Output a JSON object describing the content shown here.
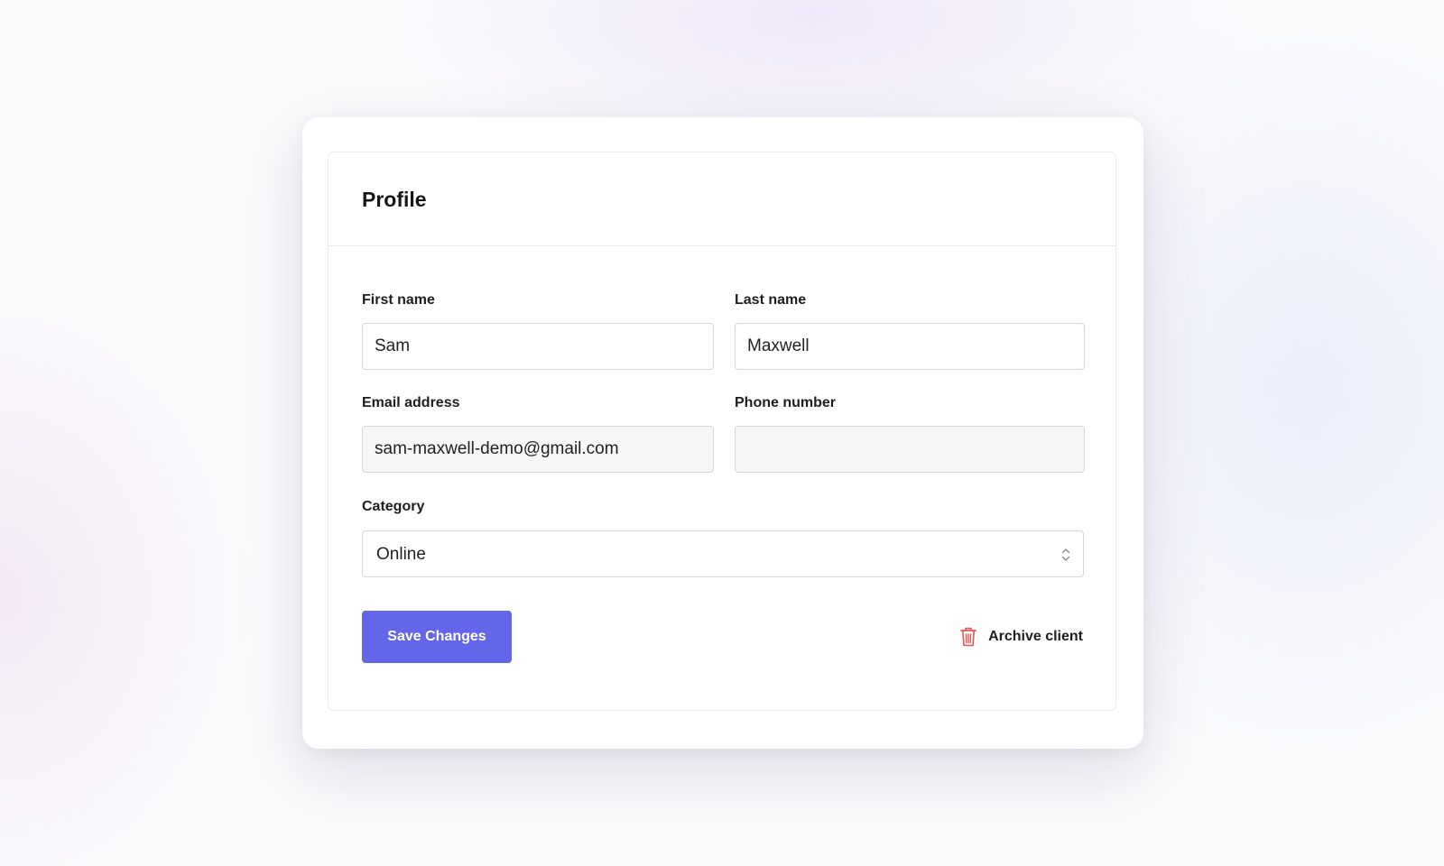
{
  "profile": {
    "title": "Profile",
    "first_name": {
      "label": "First name",
      "value": "Sam"
    },
    "last_name": {
      "label": "Last name",
      "value": "Maxwell"
    },
    "email": {
      "label": "Email address",
      "value": "sam-maxwell-demo@gmail.com"
    },
    "phone": {
      "label": "Phone number",
      "value": ""
    },
    "category": {
      "label": "Category",
      "selected": "Online"
    },
    "save_label": "Save Changes",
    "archive_label": "Archive client"
  },
  "colors": {
    "primary": "#6366e8",
    "danger": "#e05656",
    "border": "#d6d6d9",
    "disabled_bg": "#f6f6f7"
  },
  "icons": {
    "select": "chevron-up-down-icon",
    "archive": "trash-icon"
  }
}
